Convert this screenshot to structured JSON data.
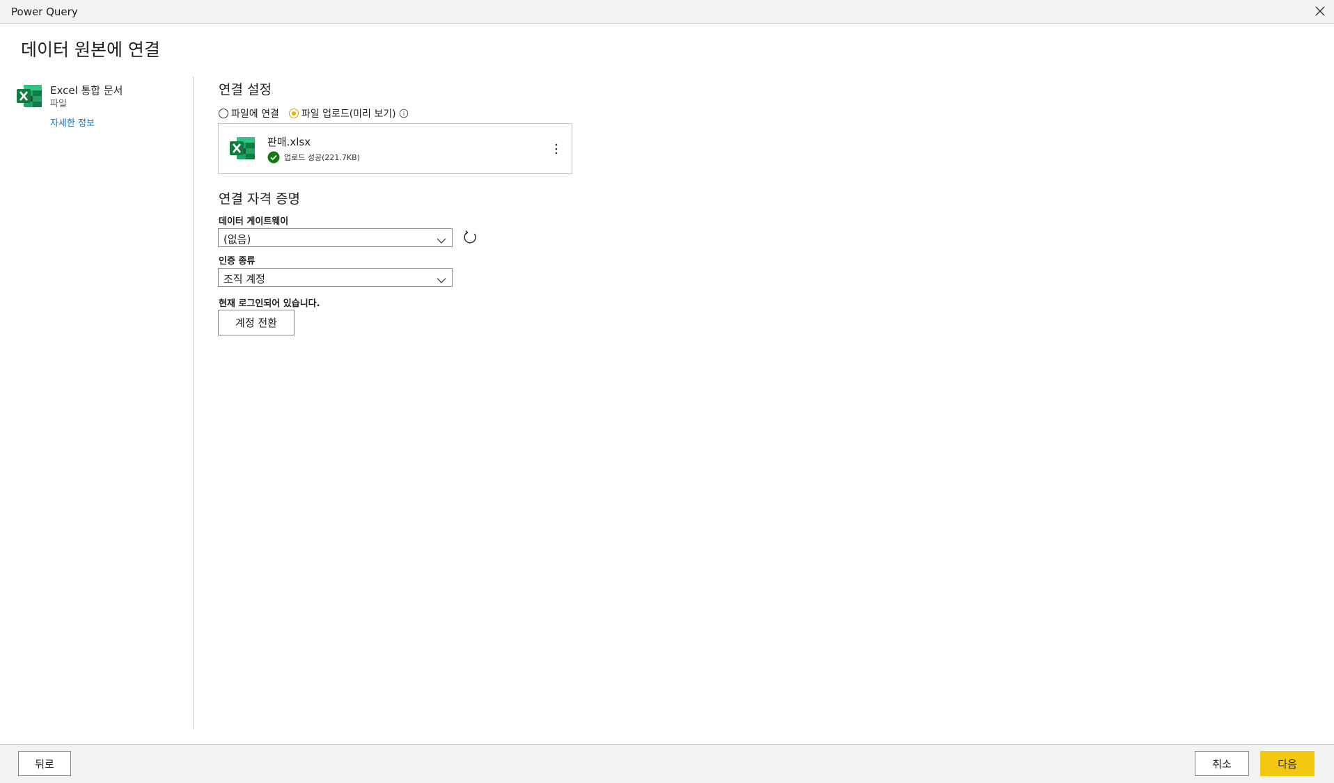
{
  "window": {
    "title": "Power Query"
  },
  "page": {
    "title": "데이터 원본에 연결"
  },
  "connector": {
    "name": "Excel 통합 문서",
    "type": "파일",
    "more_info": "자세한 정보"
  },
  "connection_settings": {
    "title": "연결 설정",
    "radio_options": [
      {
        "label": "파일에 연결",
        "checked": false
      },
      {
        "label": "파일 업로드(미리 보기)",
        "checked": true
      }
    ],
    "file": {
      "name": "판매.xlsx",
      "status": "업로드 성공(221.7KB)"
    }
  },
  "credentials": {
    "title": "연결 자격 증명",
    "gateway": {
      "label": "데이터 게이트웨이",
      "value": "(없음)"
    },
    "auth": {
      "label": "인증 종류",
      "value": "조직 계정"
    },
    "signed_in_text": "현재 로그인되어 있습니다.",
    "switch_account_label": "계정 전환"
  },
  "footer": {
    "back_label": "뒤로",
    "cancel_label": "취소",
    "next_label": "다음"
  },
  "colors": {
    "accent": "#F2C811",
    "excel_green": "#107C41",
    "link": "#0078D4",
    "success": "#107C10"
  },
  "icons": [
    "close-icon",
    "excel-logo-icon",
    "info-icon",
    "check-circle-icon",
    "more-vertical-icon",
    "chevron-down-icon",
    "refresh-icon"
  ]
}
